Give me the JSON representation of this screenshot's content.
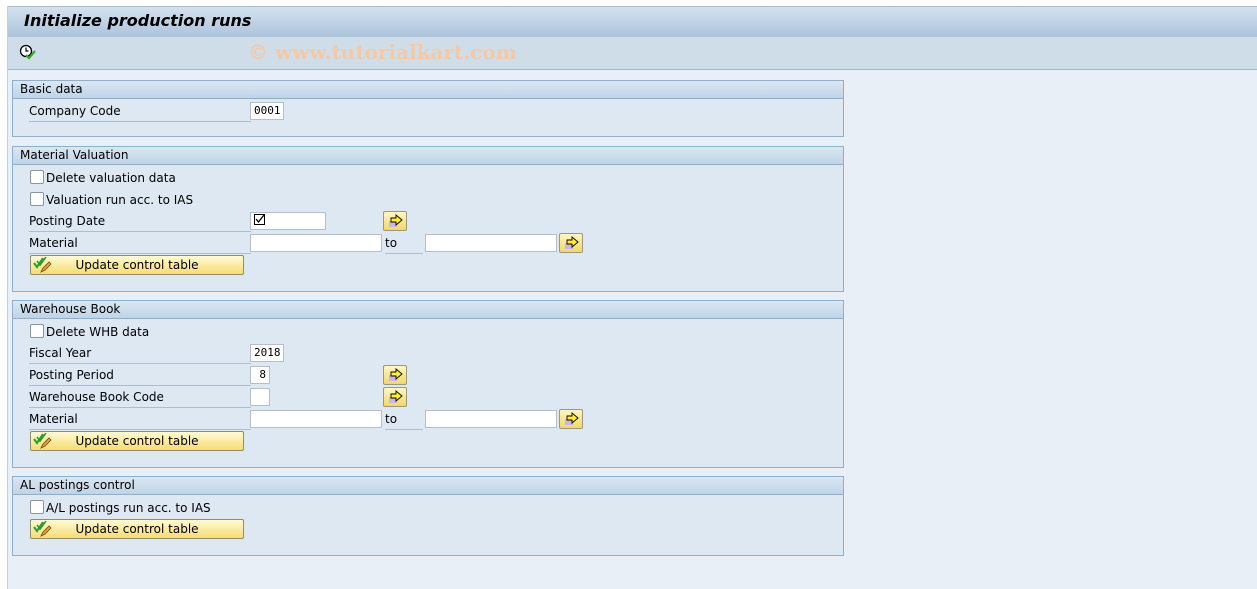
{
  "window": {
    "title": "Initialize production runs",
    "watermark": "© www.tutorialkart.com"
  },
  "toolbar": {
    "execute_icon": "clock-check-icon"
  },
  "groups": {
    "basic": {
      "title": "Basic data",
      "company_code_label": "Company Code",
      "company_code_value": "0001"
    },
    "valuation": {
      "title": "Material Valuation",
      "delete_label": "Delete valuation data",
      "delete_checked": false,
      "ias_label": "Valuation run acc. to IAS",
      "ias_checked": false,
      "posting_date_label": "Posting Date",
      "posting_date_value": "☑",
      "material_label": "Material",
      "material_from": "",
      "to_label": "to",
      "material_to": "",
      "update_button": "Update control table"
    },
    "warehouse": {
      "title": "Warehouse Book",
      "delete_label": "Delete WHB data",
      "delete_checked": false,
      "fiscal_year_label": "Fiscal Year",
      "fiscal_year_value": "2018",
      "posting_period_label": "Posting Period",
      "posting_period_value": "8",
      "whb_code_label": "Warehouse Book Code",
      "whb_code_value": "",
      "material_label": "Material",
      "material_from": "",
      "to_label": "to",
      "material_to": "",
      "update_button": "Update control table"
    },
    "al": {
      "title": "AL postings control",
      "ias_label": "A/L postings run acc. to IAS",
      "ias_checked": false,
      "update_button": "Update control table"
    }
  },
  "colors": {
    "background": "#e8eff7",
    "group_bg": "#dde8f3",
    "group_border": "#8fb0cd",
    "button_yellow": "#f5dc73",
    "watermark": "#f3c9a6"
  }
}
